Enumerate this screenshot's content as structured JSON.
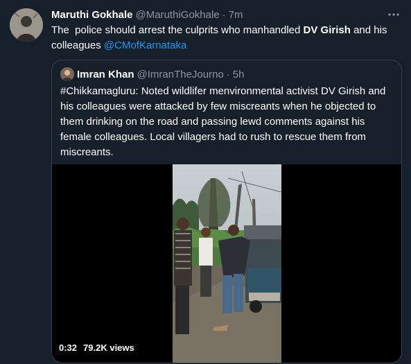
{
  "tweet": {
    "display_name": "Maruthi Gokhale",
    "handle": "@MaruthiGokhale",
    "separator": "·",
    "time": "7m",
    "text_before": "The  police should arrest the culprits who manhandled ",
    "text_bold": "DV Girish",
    "text_after": " and his colleagues ",
    "mention": "@CMofKarnataka",
    "more_icon": "more-horizontal-icon"
  },
  "quoted_tweet": {
    "display_name": "Imran Khan",
    "handle": "@ImranTheJourno",
    "separator": "·",
    "time": "5h",
    "text": "#Chikkamagluru: Noted wildlifer menvironmental activist DV Girish and his colleagues were attacked by few miscreants when he objected to them drinking on the road and passing lewd comments against his female colleagues. Local villagers had to rush to rescue them from miscreants.",
    "video": {
      "duration": "0:32",
      "views": "79.2K views"
    }
  },
  "colors": {
    "background": "#15202b",
    "text": "#ffffff",
    "secondary": "#8b98a5",
    "link": "#1d9bf0",
    "border": "#38444d"
  }
}
